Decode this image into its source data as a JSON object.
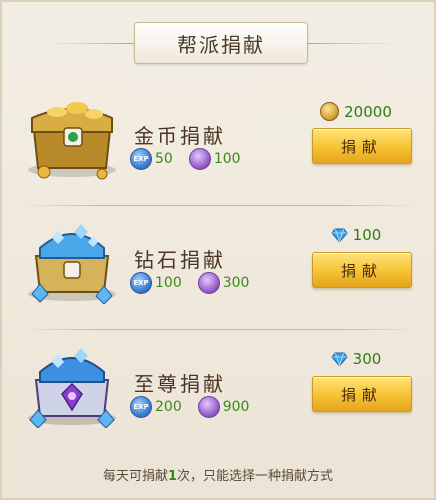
{
  "title": "帮派捐献",
  "options": [
    {
      "name": "金币捐献",
      "reward_exp": "50",
      "reward_contrib": "100",
      "cost_type": "coin",
      "cost": "20000",
      "button": "捐献"
    },
    {
      "name": "钻石捐献",
      "reward_exp": "100",
      "reward_contrib": "300",
      "cost_type": "diamond",
      "cost": "100",
      "button": "捐献"
    },
    {
      "name": "至尊捐献",
      "reward_exp": "200",
      "reward_contrib": "900",
      "cost_type": "diamond",
      "cost": "300",
      "button": "捐献"
    }
  ],
  "footer": {
    "before": "每天可捐献",
    "highlight": "1",
    "after": "次，只能选择一种捐献方式"
  },
  "colors": {
    "button": "#f6c232",
    "value_green": "#2f7c12",
    "background": "#efe8da"
  },
  "icons": {
    "reward_exp": "guild-exp-icon",
    "reward_contrib": "contribution-icon",
    "coin": "gold-coin-icon",
    "diamond": "diamond-icon"
  }
}
